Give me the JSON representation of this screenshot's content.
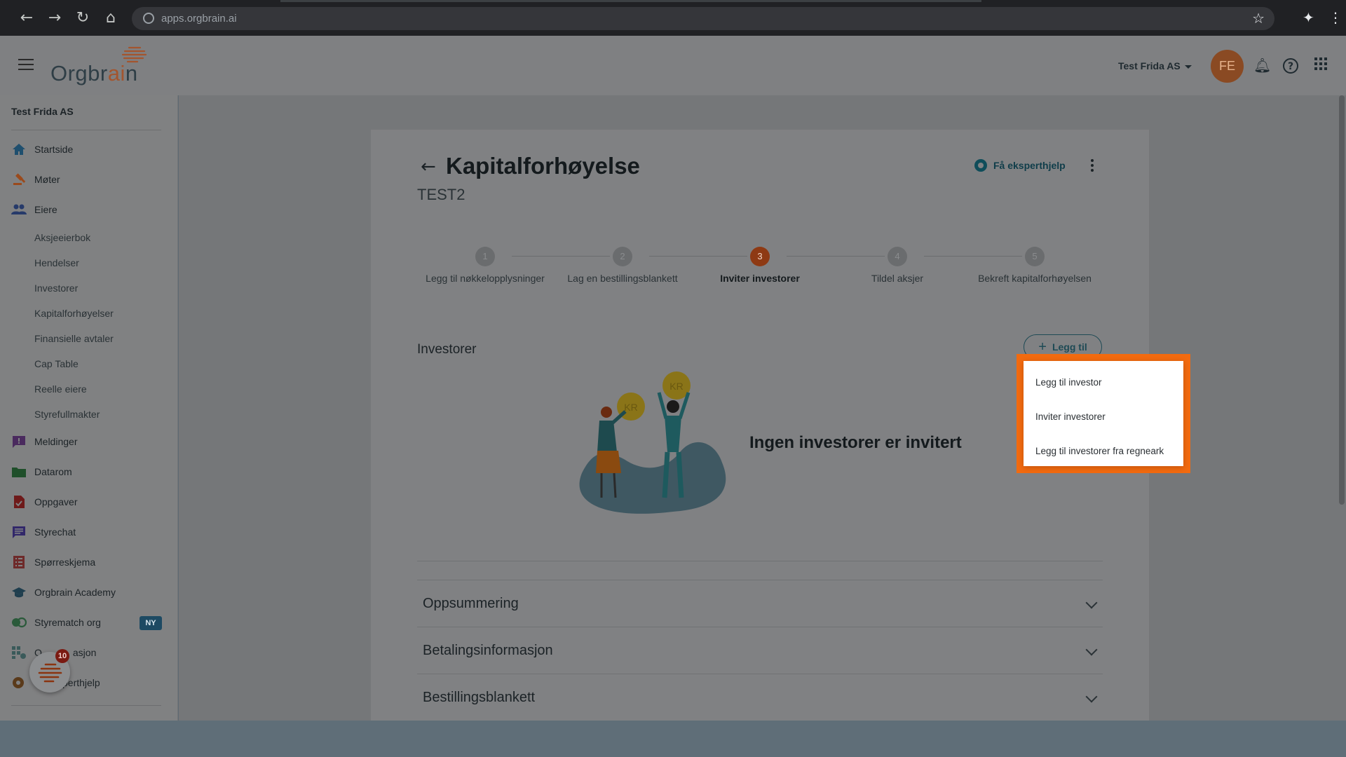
{
  "browser": {
    "url": "apps.orgbrain.ai"
  },
  "header": {
    "logo_text_main": "Orgbr",
    "logo_text_accent": "ai",
    "logo_text_end": "n",
    "company": "Test Frida AS",
    "avatar_initials": "FE"
  },
  "sidebar": {
    "org_name": "Test Frida AS",
    "items": [
      {
        "label": "Startside",
        "icon": "home-icon",
        "color": "#1f4f6e"
      },
      {
        "label": "Møter",
        "icon": "gavel-icon",
        "color": "#9a4a1c"
      },
      {
        "label": "Eiere",
        "icon": "people-icon",
        "color": "#263a6a"
      }
    ],
    "sub_items": [
      "Aksjeeierbok",
      "Hendelser",
      "Investorer",
      "Kapitalforhøyelser",
      "Finansielle avtaler",
      "Cap Table",
      "Reelle eiere",
      "Styrefullmakter"
    ],
    "items2": [
      {
        "label": "Meldinger",
        "icon": "message-alert-icon",
        "color": "#4a2a5e"
      },
      {
        "label": "Datarom",
        "icon": "folder-icon",
        "color": "#1f4f2a"
      },
      {
        "label": "Oppgaver",
        "icon": "task-icon",
        "color": "#6e1a1a"
      },
      {
        "label": "Styrechat",
        "icon": "chat-icon",
        "color": "#32286a"
      },
      {
        "label": "Spørreskjema",
        "icon": "survey-icon",
        "color": "#6e2a2a"
      },
      {
        "label": "Orgbrain Academy",
        "icon": "academy-icon",
        "color": "#1f3e4e"
      },
      {
        "label": "Styrematch org",
        "icon": "match-icon",
        "color": "#2a5a3a"
      },
      {
        "label": "Organisasjon",
        "icon": "org-chart-icon",
        "color": "#3a5a5a"
      },
      {
        "label": "Ekspert­hjelp",
        "icon": "expert-icon",
        "color": "#5a3a1a"
      }
    ],
    "visible_labels": {
      "organisasjon_partial_a": "O",
      "organisasjon_partial_b": "asjon",
      "ekspert_partial": "perthjelp"
    },
    "new_badge": "NY",
    "notification_count": "10"
  },
  "page": {
    "title": "Kapitalforhøyelse",
    "subtitle": "TEST2",
    "expert_help": "Få eksperthjelp"
  },
  "stepper": {
    "steps": [
      {
        "number": "1",
        "label": "Legg til nøkkelopplysninger"
      },
      {
        "number": "2",
        "label": "Lag en bestillingsblankett"
      },
      {
        "number": "3",
        "label": "Inviter investorer"
      },
      {
        "number": "4",
        "label": "Tildel aksjer"
      },
      {
        "number": "5",
        "label": "Bekreft kapitalforhøyelsen"
      }
    ],
    "active_step": 3
  },
  "investors": {
    "title": "Investorer",
    "add_button": "Legg til",
    "empty_text": "Ingen investorer er invitert",
    "coin_label": "KR"
  },
  "dropdown": {
    "items": [
      "Legg til investor",
      "Inviter investorer",
      "Legg til investorer fra regneark"
    ]
  },
  "accordions": [
    "Oppsummering",
    "Betalingsinformasjon",
    "Bestillingsblankett"
  ],
  "colors": {
    "highlight": "#f26a0f",
    "active_step": "#8e3a14",
    "accent": "#1e4a55"
  }
}
